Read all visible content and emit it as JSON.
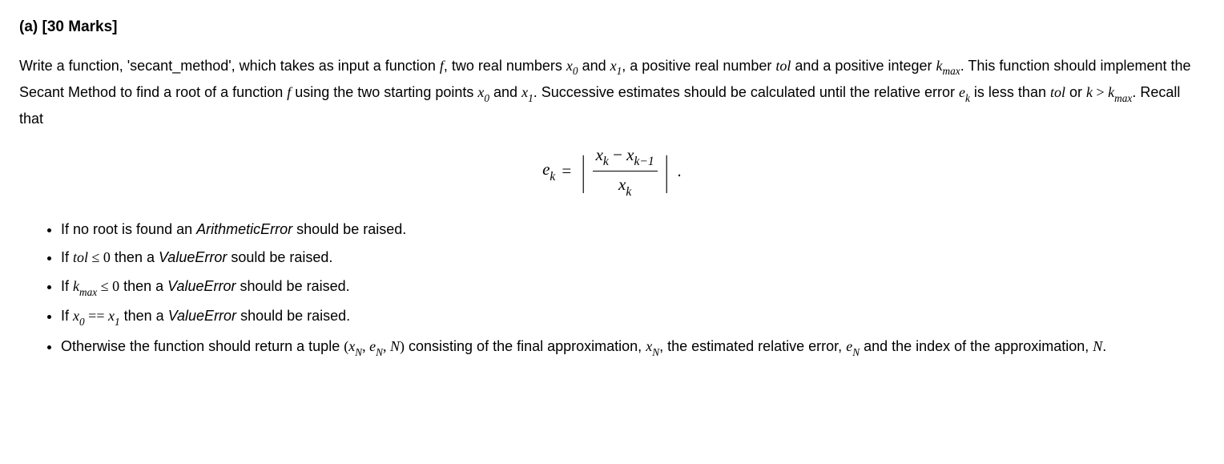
{
  "heading": "(a) [30 Marks]",
  "para": {
    "t1": "Write a function, 'secant_method', which takes as input a function ",
    "f1": "f",
    "t2": ", two real numbers ",
    "x0": "x",
    "sub0": "0",
    "t3": " and ",
    "x1": "x",
    "sub1": "1",
    "t4": ", a positive real number ",
    "tol": "tol",
    "t5": " and a positive integer ",
    "k": "k",
    "submax1": "max",
    "t6": ". This function should implement the Secant Method to find a root of a function ",
    "f2": "f",
    "t7": " using the two starting points ",
    "x0b": "x",
    "sub0b": "0",
    "t8": " and ",
    "x1b": "x",
    "sub1b": "1",
    "t9": ". Successive estimates should be calculated until the relative error ",
    "ek": "e",
    "subk": "k",
    "t10": " is less than ",
    "tol2": "tol",
    "t11": " or ",
    "k2": "k",
    "gt": " > ",
    "k3": "k",
    "submax2": "max",
    "t12": ". Recall that"
  },
  "equation": {
    "ek_e": "e",
    "ek_k": "k",
    "eq": "=",
    "num_xk_x": "x",
    "num_xk_k": "k",
    "minus": " − ",
    "num_xk1_x": "x",
    "num_xk1_k": "k−1",
    "den_x": "x",
    "den_k": "k",
    "period": "."
  },
  "bullets": {
    "b1": {
      "t1": "If no root is found an ",
      "err": "ArithmeticError",
      "t2": " should be raised."
    },
    "b2": {
      "t1": "If ",
      "tol": "tol",
      "le": " ≤ ",
      "zero": "0",
      "t2": " then a ",
      "err": "ValueError",
      "t3": " sould be raised."
    },
    "b3": {
      "t1": "If ",
      "k": "k",
      "submax": "max",
      "le": " ≤ ",
      "zero": "0",
      "t2": " then a ",
      "err": "ValueError",
      "t3": " should be raised."
    },
    "b4": {
      "t1": "If ",
      "x0": "x",
      "sub0": "0",
      "eqeq": " == ",
      "x1": "x",
      "sub1": "1",
      "t2": " then a ",
      "err": "ValueError",
      "t3": " should be raised."
    },
    "b5": {
      "t1": "Otherwise the function should return a tuple ",
      "lp": "(",
      "xN": "x",
      "subN1": "N",
      "c1": ", ",
      "eN": "e",
      "subN2": "N",
      "c2": ", ",
      "N": "N",
      "rp": ")",
      "t2": " consisting of the final approximation, ",
      "xN2": "x",
      "subN3": "N",
      "t3": ", the estimated relative error, ",
      "eN2": "e",
      "subN4": "N",
      "t4": " and the index of the approximation, ",
      "N2": "N",
      "t5": "."
    }
  }
}
